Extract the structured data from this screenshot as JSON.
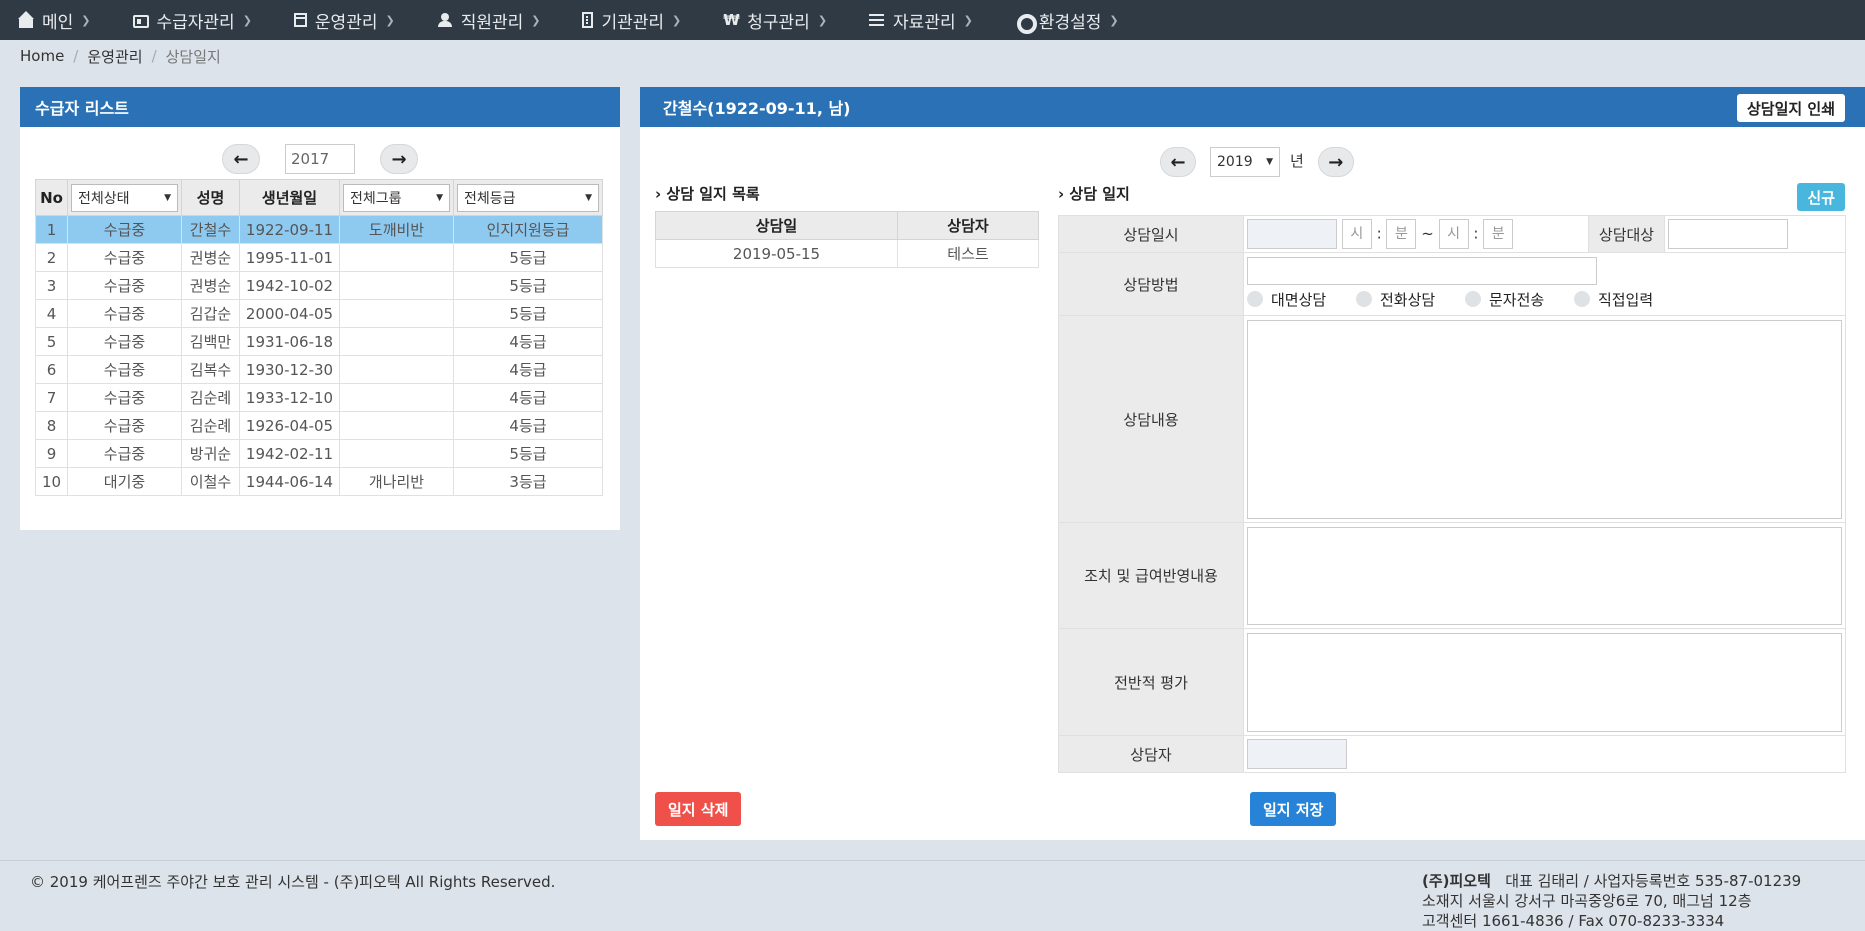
{
  "nav": [
    {
      "label": "메인",
      "icon": "home-icon"
    },
    {
      "label": "수급자관리",
      "icon": "id-card-icon"
    },
    {
      "label": "운영관리",
      "icon": "calendar-icon"
    },
    {
      "label": "직원관리",
      "icon": "users-icon"
    },
    {
      "label": "기관관리",
      "icon": "building-icon"
    },
    {
      "label": "청구관리",
      "icon": "won-icon"
    },
    {
      "label": "자료관리",
      "icon": "list-icon"
    },
    {
      "label": "환경설정",
      "icon": "gear-icon"
    }
  ],
  "breadcrumb": {
    "home": "Home",
    "section": "운영관리",
    "current": "상담일지"
  },
  "left": {
    "title": "수급자 리스트",
    "year": "2017",
    "headers": {
      "no": "No",
      "status": "전체상태",
      "name": "성명",
      "birth": "생년월일",
      "group": "전체그룹",
      "grade": "전체등급"
    },
    "rows": [
      {
        "no": "1",
        "status": "수급중",
        "name": "간철수",
        "birth": "1922-09-11",
        "group": "도깨비반",
        "grade": "인지지원등급"
      },
      {
        "no": "2",
        "status": "수급중",
        "name": "권병순",
        "birth": "1995-11-01",
        "group": "",
        "grade": "5등급"
      },
      {
        "no": "3",
        "status": "수급중",
        "name": "권병순",
        "birth": "1942-10-02",
        "group": "",
        "grade": "5등급"
      },
      {
        "no": "4",
        "status": "수급중",
        "name": "김갑순",
        "birth": "2000-04-05",
        "group": "",
        "grade": "5등급"
      },
      {
        "no": "5",
        "status": "수급중",
        "name": "김백만",
        "birth": "1931-06-18",
        "group": "",
        "grade": "4등급"
      },
      {
        "no": "6",
        "status": "수급중",
        "name": "김복수",
        "birth": "1930-12-30",
        "group": "",
        "grade": "4등급"
      },
      {
        "no": "7",
        "status": "수급중",
        "name": "김순례",
        "birth": "1933-12-10",
        "group": "",
        "grade": "4등급"
      },
      {
        "no": "8",
        "status": "수급중",
        "name": "김순례",
        "birth": "1926-04-05",
        "group": "",
        "grade": "4등급"
      },
      {
        "no": "9",
        "status": "수급중",
        "name": "방귀순",
        "birth": "1942-02-11",
        "group": "",
        "grade": "5등급"
      },
      {
        "no": "10",
        "status": "대기중",
        "name": "이철수",
        "birth": "1944-06-14",
        "group": "개나리반",
        "grade": "3등급"
      }
    ]
  },
  "right": {
    "title": "간철수(1922-09-11, 남)",
    "print_label": "상담일지 인쇄",
    "year": "2019",
    "year_suffix": "년",
    "list_title": "상담 일지 목록",
    "list_headers": {
      "date": "상담일",
      "counselor": "상담자"
    },
    "list_rows": [
      {
        "date": "2019-05-15",
        "counselor": "테스트"
      }
    ],
    "form_title": "상담 일지",
    "new_label": "신규",
    "labels": {
      "datetime": "상담일시",
      "target": "상담대상",
      "method": "상담방법",
      "content": "상담내용",
      "action": "조치 및 급여반영내용",
      "evaluation": "전반적 평가",
      "counselor": "상담자"
    },
    "time_placeholders": {
      "hour": "시",
      "minute": "분"
    },
    "time_sep_colon": ":",
    "time_sep_range": "~",
    "methods": [
      "대면상담",
      "전화상담",
      "문자전송",
      "직접입력"
    ],
    "delete_label": "일지 삭제",
    "save_label": "일지 저장"
  },
  "footer": {
    "copyright": "© 2019 케어프렌즈 주야간 보호 관리 시스템 - (주)피오텍 All Rights Reserved.",
    "company": "(주)피오텍",
    "ceo": "대표   김태리   /   사업자등록번호   535-87-01239",
    "address": "소재지   서울시 강서구 마곡중앙6로 70, 매그넘 12층",
    "contact": "고객센터   1661-4836   /   Fax   070-8233-3334"
  },
  "colors": {
    "nav_bg": "#2f3a44",
    "panel_head": "#2a72b5",
    "selected_row": "#8ec9f0",
    "btn_new": "#48b6dd",
    "btn_delete": "#f0504a",
    "btn_save": "#2683d7"
  }
}
